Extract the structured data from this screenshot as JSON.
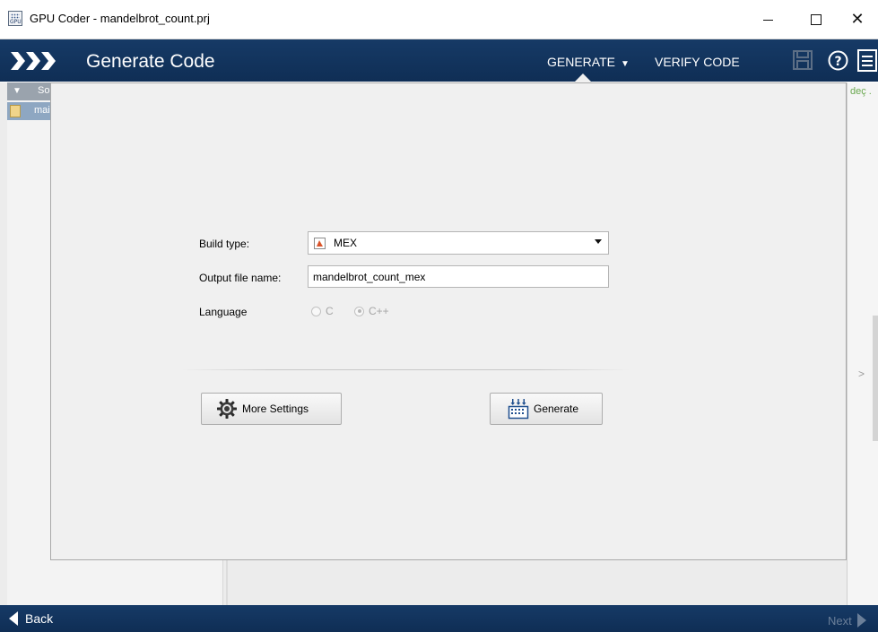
{
  "window": {
    "title": "GPU Coder - mandelbrot_count.prj",
    "icon_text": "GPU"
  },
  "toolbar": {
    "title": "Generate Code",
    "generate_label": "GENERATE",
    "verify_label": "VERIFY CODE"
  },
  "background": {
    "sections_label": "So",
    "file_label": "mai",
    "code_snippet": "deç ."
  },
  "dialog": {
    "build_type_label": "Build type:",
    "build_type_value": "MEX",
    "output_file_label": "Output file name:",
    "output_file_value": "mandelbrot_count_mex",
    "language_label": "Language",
    "language_options": [
      "C",
      "C++"
    ],
    "language_selected": "C++",
    "more_settings_label": "More Settings",
    "generate_label": "Generate"
  },
  "footer": {
    "back_label": "Back",
    "next_label": "Next"
  },
  "colors": {
    "toolbar_bg": "#163a66",
    "dialog_bg": "#f0f0f0",
    "accent_code": "#6aa84f"
  },
  "icons": [
    "gpu-coder-app-icon",
    "chevrons-icon",
    "save-icon",
    "help-icon",
    "menu-icon",
    "mex-icon",
    "gear-icon",
    "generate-grid-icon",
    "back-arrow-icon",
    "next-arrow-icon"
  ]
}
